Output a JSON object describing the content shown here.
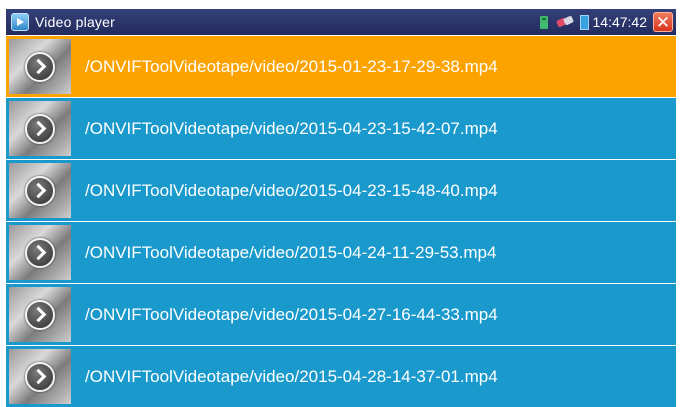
{
  "window": {
    "title": "Video player",
    "time": "14:47:42",
    "close_glyph": "✕"
  },
  "icons": {
    "app": "video-player-icon",
    "storage": "sd-card-icon",
    "network": "network-link-icon",
    "battery": "battery-icon",
    "close": "close-icon",
    "thumbnail_play": "play-icon"
  },
  "colors": {
    "title_bar": "#232b5c",
    "row": "#1a99cc",
    "row_selected": "#fda300",
    "close": "#d7331e"
  },
  "files": [
    {
      "name": "/ONVIFToolVideotape/video/2015-01-23-17-29-38.mp4",
      "selected": true
    },
    {
      "name": "/ONVIFToolVideotape/video/2015-04-23-15-42-07.mp4",
      "selected": false
    },
    {
      "name": "/ONVIFToolVideotape/video/2015-04-23-15-48-40.mp4",
      "selected": false
    },
    {
      "name": "/ONVIFToolVideotape/video/2015-04-24-11-29-53.mp4",
      "selected": false
    },
    {
      "name": "/ONVIFToolVideotape/video/2015-04-27-16-44-33.mp4",
      "selected": false
    },
    {
      "name": "/ONVIFToolVideotape/video/2015-04-28-14-37-01.mp4",
      "selected": false
    }
  ]
}
